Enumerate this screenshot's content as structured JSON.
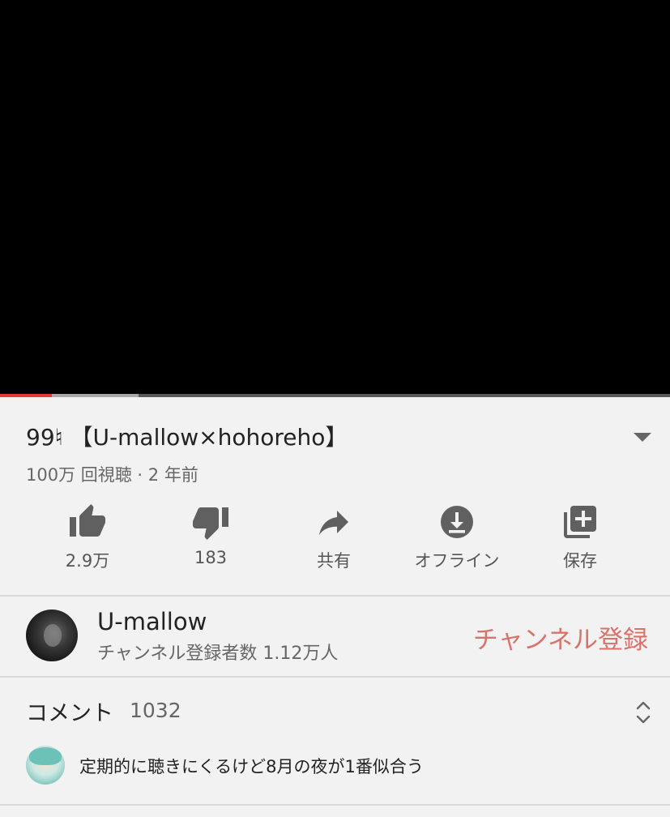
{
  "player": {
    "progress_played": 0.077,
    "progress_buffered": 0.207
  },
  "video": {
    "title": "99♮ 【U-mallow×hohoreho】",
    "meta": "100万 回視聴 · 2 年前"
  },
  "actions": [
    {
      "icon": "thumbs-up-icon",
      "label": "2.9万"
    },
    {
      "icon": "thumbs-down-icon",
      "label": "183"
    },
    {
      "icon": "share-icon",
      "label": "共有"
    },
    {
      "icon": "download-icon",
      "label": "オフライン"
    },
    {
      "icon": "playlist-add-icon",
      "label": "保存"
    }
  ],
  "channel": {
    "name": "U-mallow",
    "subscribers": "チャンネル登録者数 1.12万人",
    "subscribe_label": "チャンネル登録",
    "accent_color": "#d9726a"
  },
  "comments": {
    "label": "コメント",
    "count": "1032",
    "top_comment": "定期的に聴きにくるけど8月の夜が1番似合う"
  }
}
